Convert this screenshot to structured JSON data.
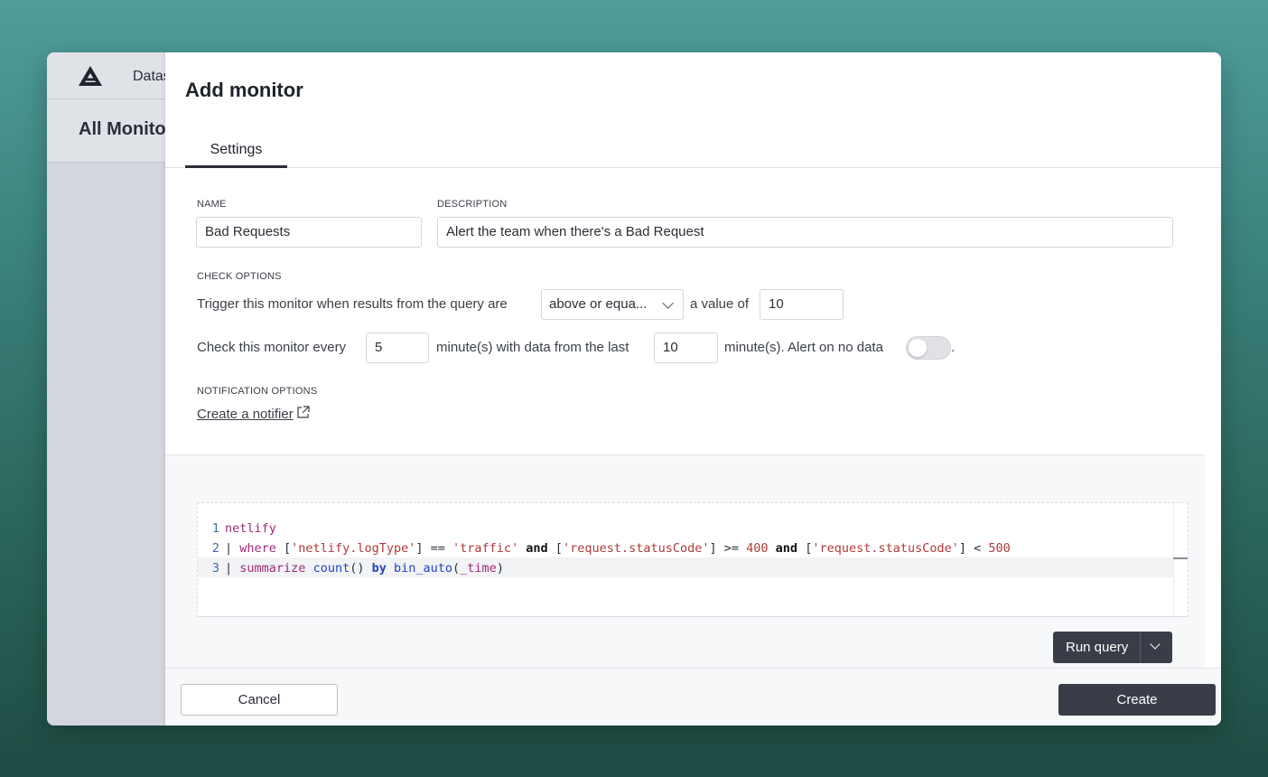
{
  "background_app": {
    "topbar_text": "Datas",
    "header_text": "All Monito"
  },
  "modal": {
    "title": "Add monitor",
    "tabs": [
      {
        "label": "Settings",
        "active": true
      }
    ],
    "name": {
      "label": "NAME",
      "value": "Bad Requests"
    },
    "description": {
      "label": "DESCRIPTION",
      "value": "Alert the team when there's a Bad Request"
    },
    "check_options": {
      "label": "CHECK OPTIONS",
      "trigger_text": "Trigger this monitor when results from the query are",
      "operator": "above or equa...",
      "value_text": "a value of",
      "value": "10",
      "every_text": "Check this monitor every",
      "interval": "5",
      "last_text": "minute(s) with data from the last",
      "range": "10",
      "no_data_text": "minute(s). Alert on no data",
      "no_data_enabled": false,
      "period": "."
    },
    "notification_options": {
      "label": "NOTIFICATION OPTIONS",
      "create_link": "Create a notifier"
    },
    "query": {
      "lines": [
        {
          "n": "1",
          "segments": [
            {
              "t": "netlify",
              "c": "kw"
            }
          ]
        },
        {
          "n": "2",
          "segments": [
            {
              "t": "| ",
              "c": "plain"
            },
            {
              "t": "where",
              "c": "kw"
            },
            {
              "t": " [",
              "c": "plain"
            },
            {
              "t": "'netlify.logType'",
              "c": "str"
            },
            {
              "t": "] == ",
              "c": "plain"
            },
            {
              "t": "'traffic'",
              "c": "str"
            },
            {
              "t": " ",
              "c": "plain"
            },
            {
              "t": "and",
              "c": "bold"
            },
            {
              "t": " [",
              "c": "plain"
            },
            {
              "t": "'request.statusCode'",
              "c": "str"
            },
            {
              "t": "] >= ",
              "c": "plain"
            },
            {
              "t": "400",
              "c": "num"
            },
            {
              "t": " ",
              "c": "plain"
            },
            {
              "t": "and",
              "c": "bold"
            },
            {
              "t": " [",
              "c": "plain"
            },
            {
              "t": "'request.statusCode'",
              "c": "str"
            },
            {
              "t": "] < ",
              "c": "plain"
            },
            {
              "t": "500",
              "c": "num"
            }
          ]
        },
        {
          "n": "3",
          "segments": [
            {
              "t": "| ",
              "c": "plain"
            },
            {
              "t": "summarize",
              "c": "kw"
            },
            {
              "t": " ",
              "c": "plain"
            },
            {
              "t": "count",
              "c": "fn"
            },
            {
              "t": "() ",
              "c": "plain"
            },
            {
              "t": "by",
              "c": "fn bold"
            },
            {
              "t": " ",
              "c": "plain"
            },
            {
              "t": "bin_auto",
              "c": "fn"
            },
            {
              "t": "(",
              "c": "plain"
            },
            {
              "t": "_time",
              "c": "kw"
            },
            {
              "t": ")",
              "c": "plain"
            }
          ]
        }
      ]
    },
    "run_query_label": "Run query",
    "cancel_label": "Cancel",
    "create_label": "Create"
  }
}
